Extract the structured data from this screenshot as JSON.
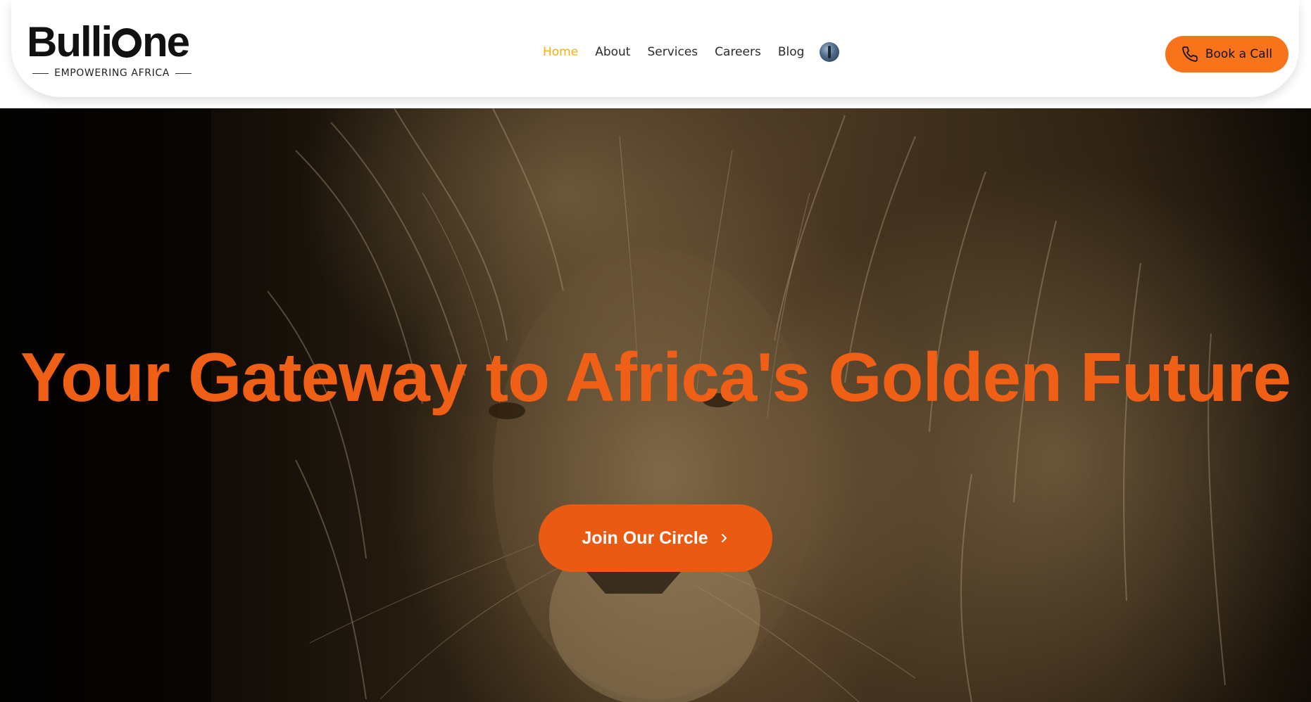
{
  "header": {
    "logo": {
      "wordmark_prefix": "Bulli",
      "wordmark_suffix": "ne",
      "tagline": "EMPOWERING AFRICA"
    },
    "nav": {
      "items": [
        {
          "label": "Home",
          "active": true
        },
        {
          "label": "About",
          "active": false
        },
        {
          "label": "Services",
          "active": false
        },
        {
          "label": "Careers",
          "active": false
        },
        {
          "label": "Blog",
          "active": false
        }
      ],
      "language_icon": "globe-flag-icon"
    },
    "book_call": {
      "label": "Book a Call",
      "icon": "phone-icon"
    }
  },
  "hero": {
    "title": "Your Gateway to Africa's Golden Future",
    "cta": {
      "label": "Join Our Circle",
      "icon": "chevron-right-icon"
    },
    "background": "lion-photo"
  },
  "colors": {
    "accent_orange": "#ef5f15",
    "button_orange": "#f9731a",
    "nav_active": "#f5b10a",
    "nav_text": "#2b2b2b"
  }
}
